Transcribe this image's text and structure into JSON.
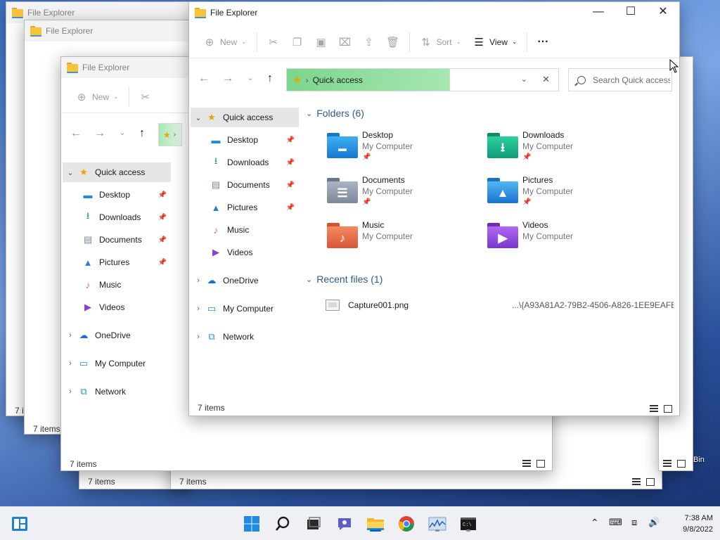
{
  "background_windows": [
    {
      "title": "File Explorer",
      "status": "7 items"
    },
    {
      "title": "File Explorer",
      "status": "7 items"
    },
    {
      "title": "File Explorer",
      "status": "7 items",
      "toolbar_new": "New",
      "nav": {
        "quick_access": "Quick access",
        "desktop": "Desktop",
        "downloads": "Downloads",
        "documents": "Documents",
        "pictures": "Pictures",
        "music": "Music",
        "videos": "Videos",
        "onedrive": "OneDrive",
        "my_computer": "My Computer",
        "network": "Network"
      }
    },
    {
      "status": "7 items"
    },
    {
      "status": "7 items"
    }
  ],
  "desktop": {
    "recycle_bin_label": "Bin"
  },
  "window": {
    "title": "File Explorer",
    "toolbar": {
      "new": "New",
      "sort": "Sort",
      "view": "View",
      "more": "···"
    },
    "address": {
      "location": "Quick access"
    },
    "search": {
      "placeholder": "Search Quick access"
    },
    "nav": {
      "quick_access": "Quick access",
      "desktop": "Desktop",
      "downloads": "Downloads",
      "documents": "Documents",
      "pictures": "Pictures",
      "music": "Music",
      "videos": "Videos",
      "onedrive": "OneDrive",
      "my_computer": "My Computer",
      "network": "Network"
    },
    "folders_header": "Folders (6)",
    "folders": [
      {
        "name": "Desktop",
        "location": "My Computer",
        "pinned": true,
        "icon": "desktop-folder-icon"
      },
      {
        "name": "Downloads",
        "location": "My Computer",
        "pinned": true,
        "icon": "downloads-folder-icon"
      },
      {
        "name": "Documents",
        "location": "My Computer",
        "pinned": true,
        "icon": "documents-folder-icon"
      },
      {
        "name": "Pictures",
        "location": "My Computer",
        "pinned": true,
        "icon": "pictures-folder-icon"
      },
      {
        "name": "Music",
        "location": "My Computer",
        "pinned": false,
        "icon": "music-folder-icon"
      },
      {
        "name": "Videos",
        "location": "My Computer",
        "pinned": false,
        "icon": "videos-folder-icon"
      }
    ],
    "recent_header": "Recent files (1)",
    "recent_files": [
      {
        "name": "Capture001.png",
        "path": "...\\{A93A81A2-79B2-4506-A826-1EE9EAFE..."
      }
    ],
    "status": "7 items"
  },
  "taskbar": {
    "time": "7:38 AM",
    "date": "9/8/2022"
  },
  "colors": {
    "accent": "#0067c0",
    "address_highlight": "#7bd68c",
    "folder_yellow": "#f8c23a"
  }
}
